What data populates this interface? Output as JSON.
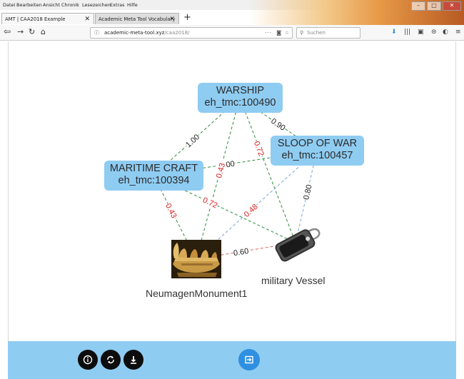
{
  "menu": [
    "Datei",
    "Bearbeiten",
    "Ansicht",
    "Chronik",
    "Lesezeichen",
    "Extras",
    "Hilfe"
  ],
  "tabs": [
    {
      "title": "AMT | CAA2018 Example",
      "active": true
    },
    {
      "title": "Academic Meta Tool Vocabulary",
      "active": false
    }
  ],
  "url": {
    "domain": "academic-meta-tool.xyz",
    "path": "/caa2018/"
  },
  "search_placeholder": "Suchen",
  "colors": {
    "node": "#8fccf2",
    "edge_green": "#2e8b3a",
    "edge_blue": "#7aa8d8",
    "edge_red_label": "#d92020",
    "bottom_bar": "#8fccf2",
    "exit_button": "#2f8fe0"
  },
  "graph": {
    "nodes": [
      {
        "id": "warship",
        "line1": "WARSHIP",
        "line2": "eh_tmc:100490"
      },
      {
        "id": "sloop",
        "line1": "SLOOP OF WAR",
        "line2": "eh_tmc:100457"
      },
      {
        "id": "maritime",
        "line1": "MARITIME CRAFT",
        "line2": "eh_tmc:100394"
      },
      {
        "id": "vessel",
        "label": "military Vessel",
        "icon": "tag-icon"
      },
      {
        "id": "monument",
        "label": "NeumagenMonument1",
        "image": "roman-ship-relief"
      }
    ],
    "edges": [
      {
        "from": "warship",
        "to": "maritime",
        "weight": "1.00",
        "style": "green-dash"
      },
      {
        "from": "warship",
        "to": "sloop",
        "weight": "0.90",
        "style": "green-dash"
      },
      {
        "from": "maritime",
        "to": "sloop",
        "weight": "0.00",
        "style": "green-dash"
      },
      {
        "from": "warship",
        "to": "monument",
        "weight": "0.43",
        "style": "green-dash",
        "label_color": "red"
      },
      {
        "from": "warship",
        "to": "vessel",
        "weight": "0.72",
        "style": "green-dash",
        "label_color": "red"
      },
      {
        "from": "sloop",
        "to": "vessel",
        "weight": "0.80",
        "style": "blue-dash"
      },
      {
        "from": "sloop",
        "to": "monument",
        "weight": "0.48",
        "style": "blue-dash",
        "label_color": "red"
      },
      {
        "from": "maritime",
        "to": "monument",
        "weight": "0.43",
        "style": "green-dash",
        "label_color": "red"
      },
      {
        "from": "maritime",
        "to": "vessel",
        "weight": "0.72",
        "style": "green-dash",
        "label_color": "red"
      },
      {
        "from": "monument",
        "to": "vessel",
        "weight": "0.60",
        "style": "red-dash"
      }
    ]
  },
  "bottom_buttons": [
    {
      "name": "info",
      "glyph": "i"
    },
    {
      "name": "refresh",
      "glyph": "⟳"
    },
    {
      "name": "download",
      "glyph": "⬇"
    }
  ]
}
